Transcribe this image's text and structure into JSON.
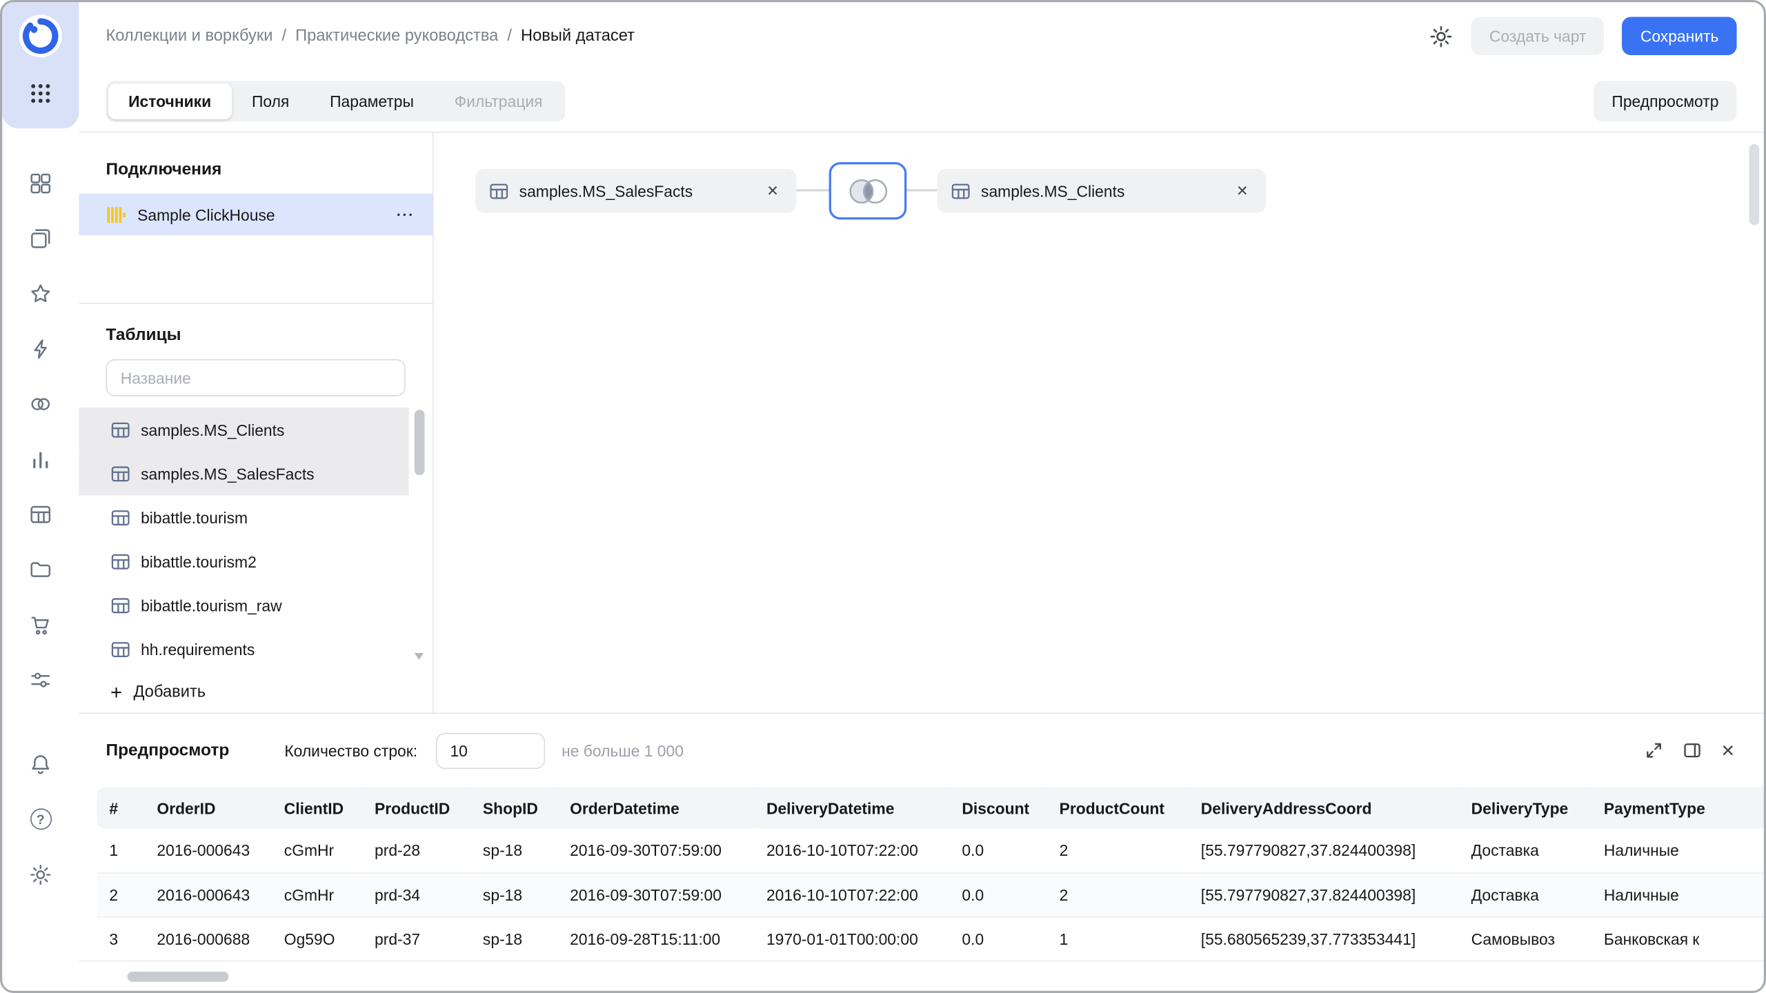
{
  "colors": {
    "accent_blue": "#3a72f4",
    "selection_blue": "#dbe5fb",
    "clickhouse_yellow": "#f6c51e",
    "rail_top_bg": "#d8e1f8",
    "icon_gray": "#68727f",
    "text_primary": "#17181a",
    "text_secondary": "#7c828a",
    "text_disabled": "#a9adb3",
    "surface_gray": "#f0f1f3",
    "selected_row_gray": "#ebebed",
    "border_gray": "#e5e6e9",
    "node_border_blue": "#4a7af5",
    "table_icon_blue": "#61708f"
  },
  "icons": {
    "close_glyph": "×",
    "more_glyph": "···",
    "plus_glyph": "+",
    "help_glyph": "?"
  },
  "header": {
    "breadcrumb": [
      {
        "label": "Коллекции и воркбуки"
      },
      {
        "label": "Практические руководства"
      },
      {
        "label": "Новый датасет"
      }
    ],
    "separator": "/",
    "create_chart_label": "Создать чарт",
    "save_label": "Сохранить"
  },
  "tabs": {
    "sources": "Источники",
    "fields": "Поля",
    "parameters": "Параметры",
    "filtering": "Фильтрация",
    "preview_button": "Предпросмотр"
  },
  "connections": {
    "title": "Подключения",
    "selected": "Sample ClickHouse"
  },
  "tables_panel": {
    "title": "Таблицы",
    "search_placeholder": "Название",
    "items": [
      "samples.MS_Clients",
      "samples.MS_SalesFacts",
      "bibattle.tourism",
      "bibattle.tourism2",
      "bibattle.tourism_raw",
      "hh.requirements"
    ],
    "add_label": "Добавить"
  },
  "canvas": {
    "left_table": "samples.MS_SalesFacts",
    "right_table": "samples.MS_Clients"
  },
  "preview": {
    "title": "Предпросмотр",
    "rows_label": "Количество строк:",
    "rows_value": "10",
    "rows_hint": "не больше 1 000",
    "columns": [
      "#",
      "OrderID",
      "ClientID",
      "ProductID",
      "ShopID",
      "OrderDatetime",
      "DeliveryDatetime",
      "Discount",
      "ProductCount",
      "DeliveryAddressCoord",
      "DeliveryType",
      "PaymentType"
    ],
    "rows": [
      [
        "1",
        "2016-000643",
        "cGmHr",
        "prd-28",
        "sp-18",
        "2016-09-30T07:59:00",
        "2016-10-10T07:22:00",
        "0.0",
        "2",
        "[55.797790827,37.824400398]",
        "Доставка",
        "Наличные"
      ],
      [
        "2",
        "2016-000643",
        "cGmHr",
        "prd-34",
        "sp-18",
        "2016-09-30T07:59:00",
        "2016-10-10T07:22:00",
        "0.0",
        "2",
        "[55.797790827,37.824400398]",
        "Доставка",
        "Наличные"
      ],
      [
        "3",
        "2016-000688",
        "Og59O",
        "prd-37",
        "sp-18",
        "2016-09-28T15:11:00",
        "1970-01-01T00:00:00",
        "0.0",
        "1",
        "[55.680565239,37.773353441]",
        "Самовывоз",
        "Банковская к"
      ]
    ]
  }
}
